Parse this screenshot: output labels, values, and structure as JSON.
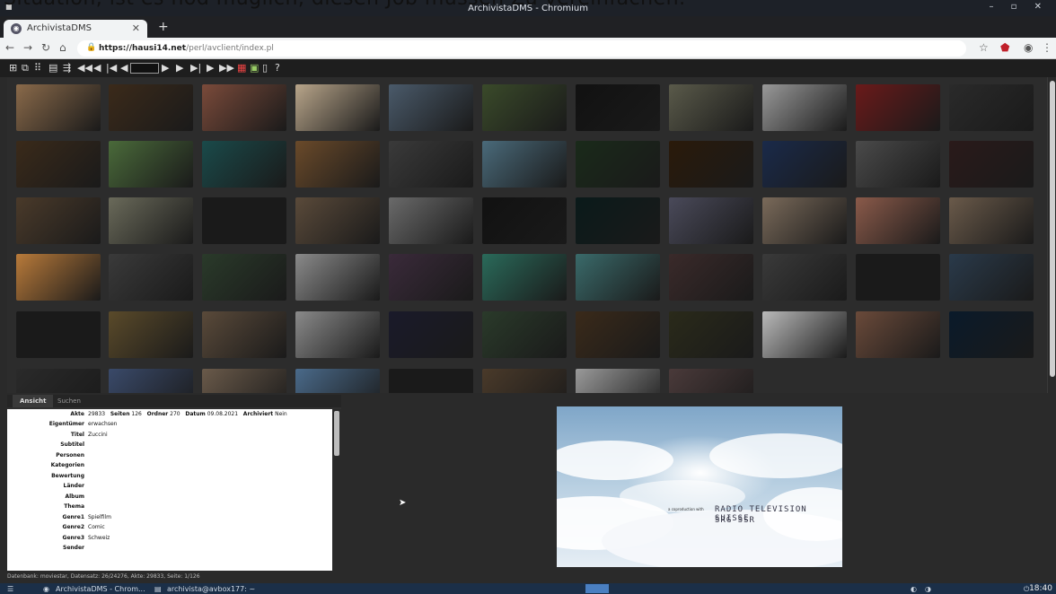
{
  "caption": "Situation, ist es nod müglich, diesen Job müssen Zu vereinfachen.",
  "os": {
    "window_title": "ArchivistaDMS - Chromium",
    "window_controls": "– ▫ ✕"
  },
  "browser": {
    "tab_label": "ArchivistaDMS",
    "url_host": "https://hausi14.net",
    "url_path": "/perl/avclient/index.pl"
  },
  "app": {
    "icons": [
      "view-icon",
      "copy-icon",
      "grid-icon",
      "list-icon",
      "select-icon",
      "first-icon",
      "rewind-icon",
      "prev-page-icon",
      "prev-icon",
      "next-icon",
      "forward-icon",
      "next-page-icon",
      "last-icon",
      "fast-forward-icon",
      "table-icon",
      "image-icon",
      "page-icon",
      "help-icon"
    ],
    "help_label": "?"
  },
  "thumbnails": {
    "rows": [
      [
        "#8a6a4a",
        "#3b2a1a",
        "#7a4a3a",
        "#b8a58a",
        "#4a5a6a",
        "#3a4a2a",
        "#111111",
        "#5a5a4a",
        "#999999",
        "#6a1a1a",
        "#2a2a2a"
      ],
      [
        "#3a2a1a",
        "#4a6a3a",
        "#1a4a4a",
        "#6a4a2a",
        "#3a3a3a",
        "#4a6a7a",
        "#1a2a1a",
        "#2a1a0a",
        "#1a2a4a",
        "#4a4a4a",
        "#2a1a1a"
      ],
      [
        "#4a3a2a",
        "#6a6a5a",
        "#1a1a1a",
        "#5a4a3a",
        "#6a6a6a",
        "#111111",
        "#0a1a1a",
        "#4a4a5a",
        "#7a6a5a",
        "#8a5a4a",
        "#6a5a4a"
      ],
      [
        "#b87a3a",
        "#3a3a3a",
        "#2a3a2a",
        "#8a8a8a",
        "#3a2a3a",
        "#2a6a5a",
        "#3a6a6a",
        "#3a2a2a",
        "#3a3a3a",
        "#1a1a1a",
        "#2a3a4a"
      ],
      [
        "#1a1a1a",
        "#5a4a2a",
        "#5a4a3a",
        "#8a8a8a",
        "#1a1a2a",
        "#2a3a2a",
        "#3a2a1a",
        "#2a2a1a",
        "#bababa",
        "#6a4a3a",
        "#0a1a2a"
      ],
      [
        "#2a2a2a",
        "#3a4a6a",
        "#6a5a4a",
        "#4a6a8a",
        "#1a1a1a",
        "#4a3a2a",
        "#9a9a9a",
        "#4a3a3a"
      ]
    ]
  },
  "panel": {
    "tabs": [
      "Ansicht",
      "Suchen"
    ],
    "record": {
      "akte_label": "Akte",
      "akte": "29833",
      "seiten_label": "Seiten",
      "seiten": "126",
      "ordner_label": "Ordner",
      "ordner": "270",
      "datum_label": "Datum",
      "datum": "09.08.2021",
      "archiviert_label": "Archiviert",
      "archiviert": "Nein"
    },
    "fields": [
      {
        "label": "Eigentümer",
        "value": "erwachsen"
      },
      {
        "label": "Titel",
        "value": "Zuccini"
      },
      {
        "label": "Subtitel",
        "value": ""
      },
      {
        "label": "Personen",
        "value": ""
      },
      {
        "label": "Kategorien",
        "value": ""
      },
      {
        "label": "Bewertung",
        "value": ""
      },
      {
        "label": "Länder",
        "value": ""
      },
      {
        "label": "Album",
        "value": ""
      },
      {
        "label": "Thema",
        "value": ""
      },
      {
        "label": "Genre1",
        "value": "Spielfilm"
      },
      {
        "label": "Genre2",
        "value": "Comic"
      },
      {
        "label": "Genre3",
        "value": "Schweiz"
      },
      {
        "label": "Sender",
        "value": ""
      }
    ]
  },
  "preview": {
    "small_text": "a coproduction with",
    "line1": "RADIO TELEVISION SUISSE",
    "line2": "SRG SSR"
  },
  "status": "Datenbank: moviestar, Datensatz: 26/24276, Akte: 29833, Seite: 1/126",
  "taskbar": {
    "item1": "ArchivistaDMS - Chrom...",
    "item2": "archivista@avbox177: ~",
    "clock": "18:40"
  }
}
